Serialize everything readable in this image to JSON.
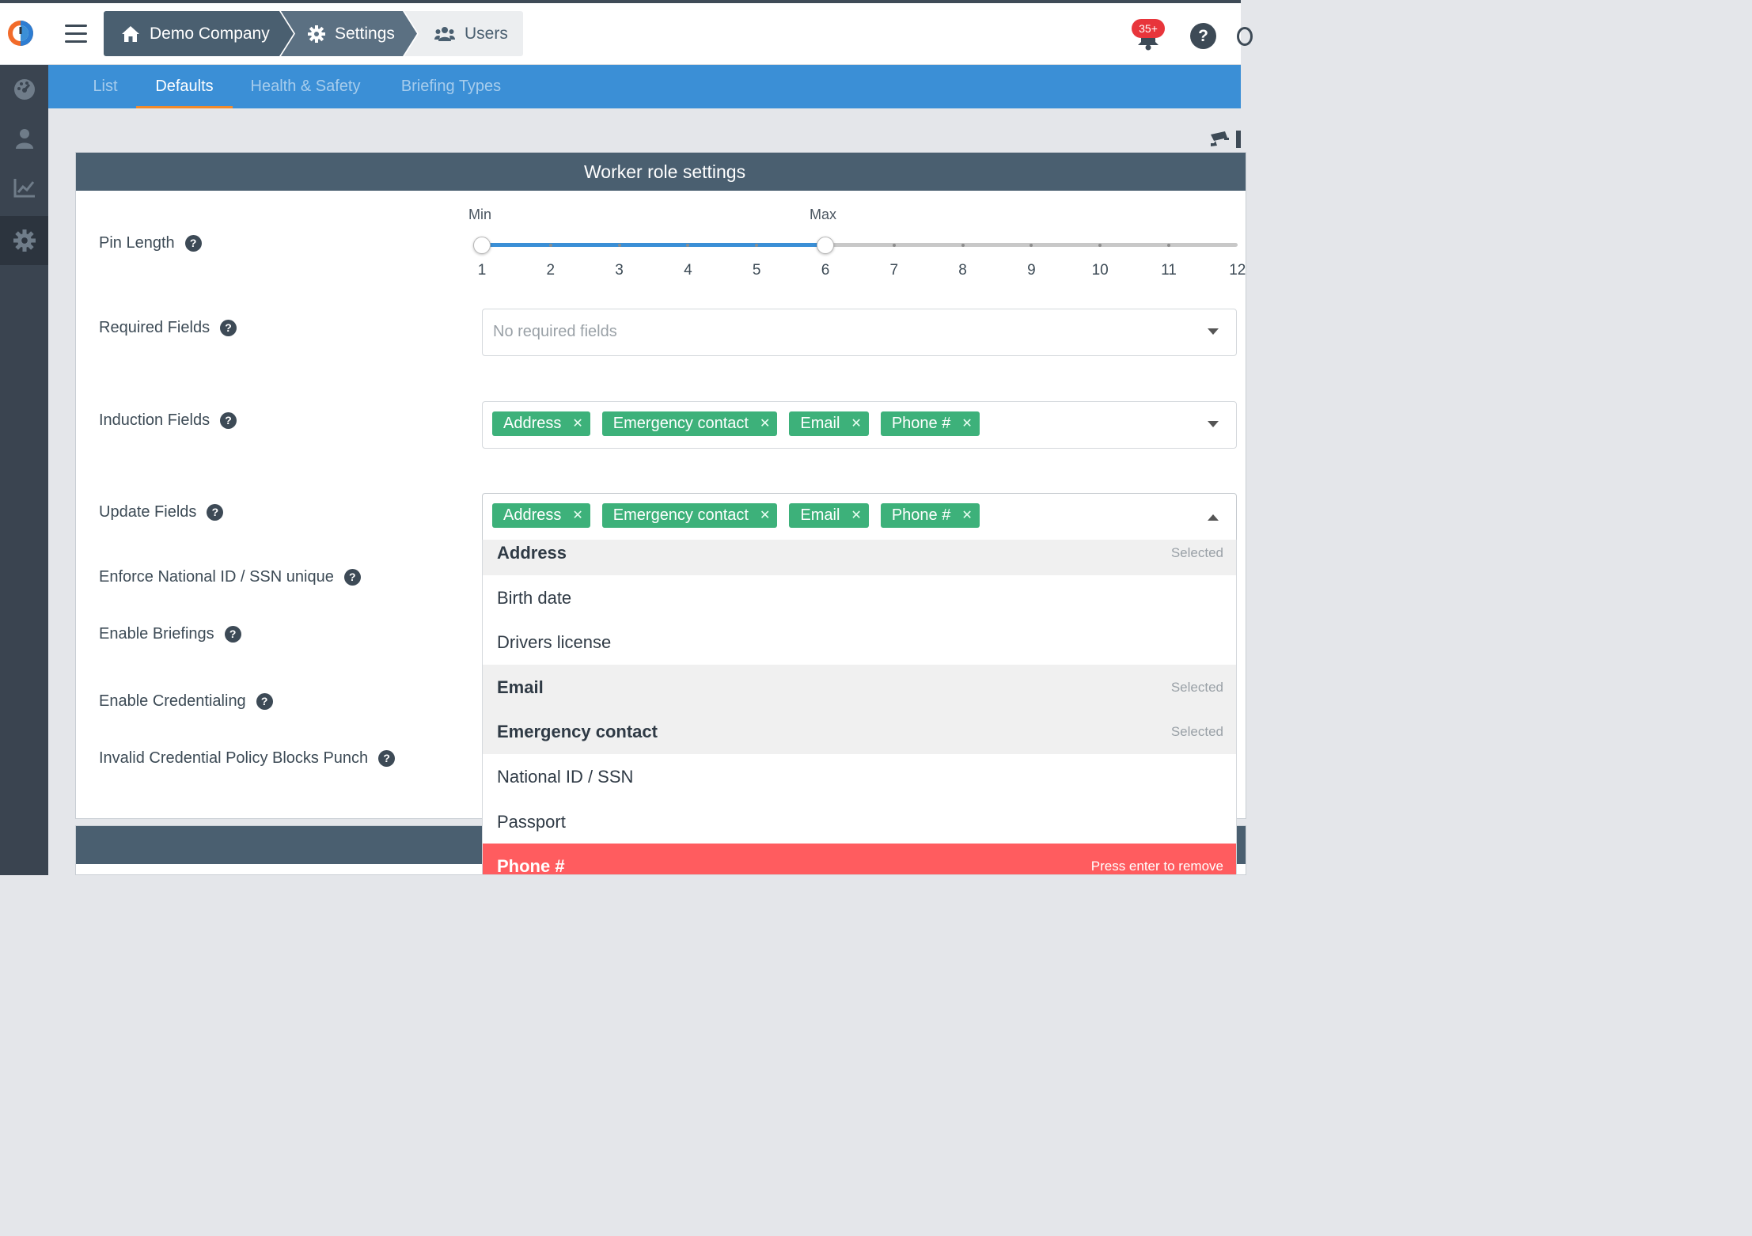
{
  "breadcrumbs": [
    {
      "label": "Demo Company",
      "icon": "home-icon"
    },
    {
      "label": "Settings",
      "icon": "gear-icon"
    },
    {
      "label": "Users",
      "icon": "users-icon"
    }
  ],
  "notifications": {
    "badge": "35+"
  },
  "help": {
    "label": "?"
  },
  "sidebar": {
    "items": [
      "dashboard-icon",
      "user-icon",
      "chart-icon",
      "gear-icon"
    ],
    "active": 3
  },
  "tabs": [
    {
      "label": "List"
    },
    {
      "label": "Defaults",
      "active": true
    },
    {
      "label": "Health & Safety"
    },
    {
      "label": "Briefing Types"
    }
  ],
  "panel": {
    "title": "Worker role settings"
  },
  "pin_length": {
    "label": "Pin Length",
    "min_label": "Min",
    "max_label": "Max",
    "ticks": [
      "1",
      "2",
      "3",
      "4",
      "5",
      "6",
      "7",
      "8",
      "9",
      "10",
      "11",
      "12"
    ],
    "min_value": 1,
    "max_value": 6
  },
  "required_fields": {
    "label": "Required Fields",
    "placeholder": "No required fields"
  },
  "induction_fields": {
    "label": "Induction Fields",
    "tags": [
      "Address",
      "Emergency contact",
      "Email",
      "Phone #"
    ]
  },
  "update_fields": {
    "label": "Update Fields",
    "tags": [
      "Address",
      "Emergency contact",
      "Email",
      "Phone #"
    ]
  },
  "other_labels": {
    "enforce_ssn": "Enforce National ID / SSN unique",
    "enable_briefings": "Enable Briefings",
    "enable_credentialing": "Enable Credentialing",
    "invalid_credential": "Invalid Credential Policy Blocks Punch"
  },
  "dropdown": {
    "options": [
      {
        "label": "Address",
        "hint": "Selected",
        "state": "selected"
      },
      {
        "label": "Birth date",
        "hint": "",
        "state": "normal"
      },
      {
        "label": "Drivers license",
        "hint": "",
        "state": "normal"
      },
      {
        "label": "Email",
        "hint": "Selected",
        "state": "selected"
      },
      {
        "label": "Emergency contact",
        "hint": "Selected",
        "state": "selected"
      },
      {
        "label": "National ID / SSN",
        "hint": "",
        "state": "normal"
      },
      {
        "label": "Passport",
        "hint": "",
        "state": "normal"
      },
      {
        "label": "Phone #",
        "hint": "Press enter to remove",
        "state": "highlight"
      }
    ]
  },
  "colors": {
    "accent": "#3b8fd6",
    "tag": "#3db17a",
    "highlight": "#ff5c5f",
    "header": "#4a5f70",
    "tab_underline": "#f08a2c"
  }
}
